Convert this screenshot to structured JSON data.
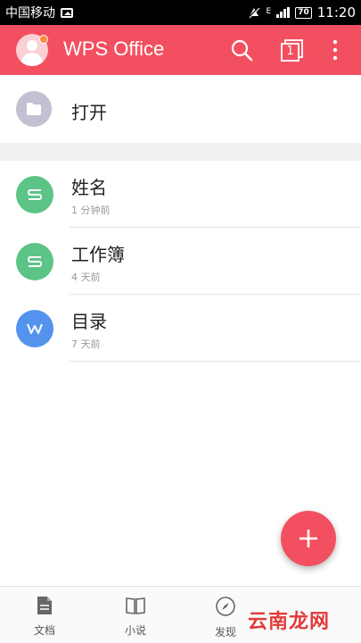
{
  "status_bar": {
    "carrier": "中国移动",
    "network": "E",
    "battery": "70",
    "time": "11:20"
  },
  "app_bar": {
    "title": "WPS Office",
    "icons": [
      "avatar",
      "search-icon",
      "tab-counter-icon",
      "more-vert-icon"
    ],
    "tab_count": "1"
  },
  "open_row": {
    "label": "打开",
    "icon": "folder-icon"
  },
  "files": [
    {
      "name": "姓名",
      "time": "1 分钟前",
      "type_letter": "S",
      "color": "#5cc486"
    },
    {
      "name": "工作簿",
      "time": "4 天前",
      "type_letter": "S",
      "color": "#5cc486"
    },
    {
      "name": "目录",
      "time": "7 天前",
      "type_letter": "W",
      "color": "#5393ee"
    }
  ],
  "fab": {
    "icon": "plus-icon"
  },
  "bottom_nav": [
    {
      "label": "文档",
      "icon": "document-icon"
    },
    {
      "label": "小说",
      "icon": "book-icon"
    },
    {
      "label": "发现",
      "icon": "compass-icon"
    }
  ],
  "watermark": "云南龙网",
  "colors": {
    "accent": "#f25060",
    "spreadsheet": "#5cc486",
    "writer": "#5393ee",
    "folder": "#c1c1d2"
  }
}
